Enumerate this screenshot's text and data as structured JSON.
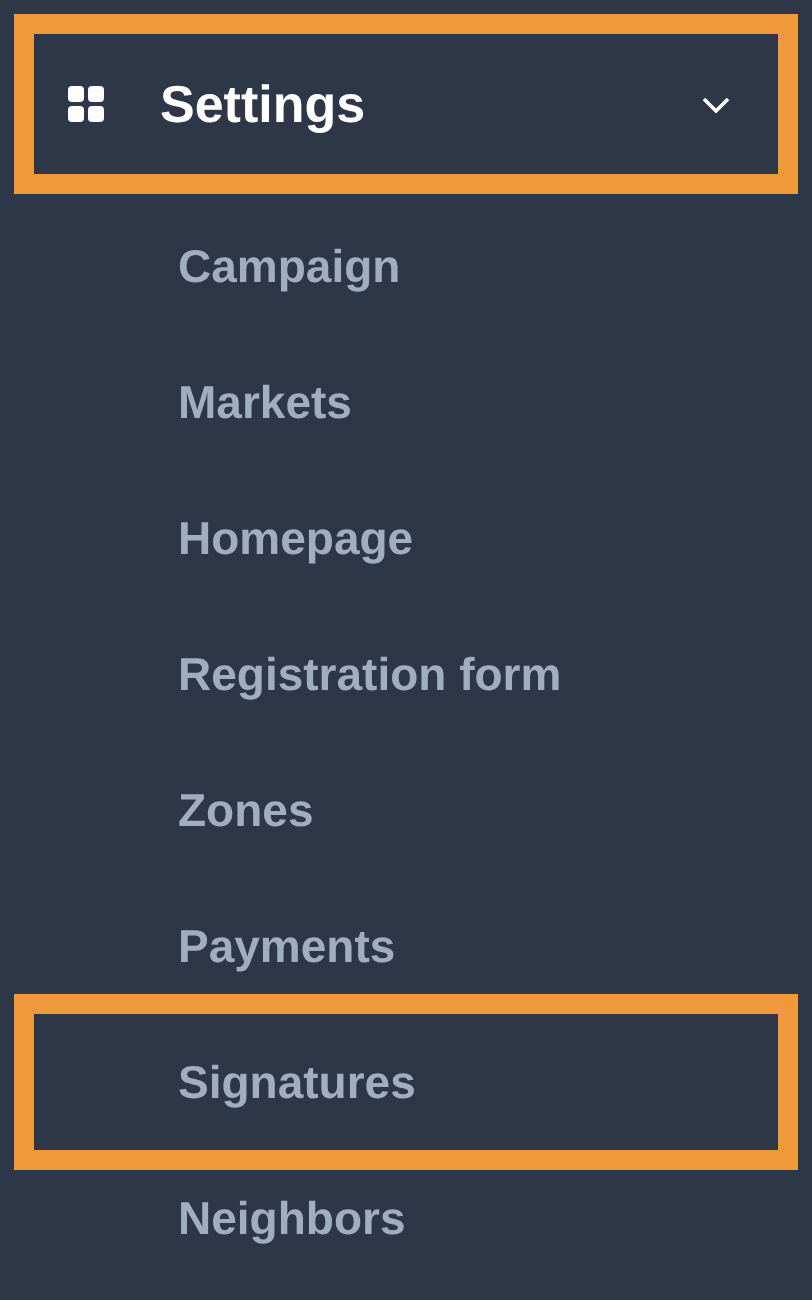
{
  "menu": {
    "title": "Settings",
    "expanded": true,
    "highlighted": true,
    "items": [
      {
        "label": "Campaign",
        "highlighted": false
      },
      {
        "label": "Markets",
        "highlighted": false
      },
      {
        "label": "Homepage",
        "highlighted": false
      },
      {
        "label": "Registration form",
        "highlighted": false
      },
      {
        "label": "Zones",
        "highlighted": false
      },
      {
        "label": "Payments",
        "highlighted": false
      },
      {
        "label": "Signatures",
        "highlighted": true
      },
      {
        "label": "Neighbors",
        "highlighted": false
      }
    ]
  }
}
